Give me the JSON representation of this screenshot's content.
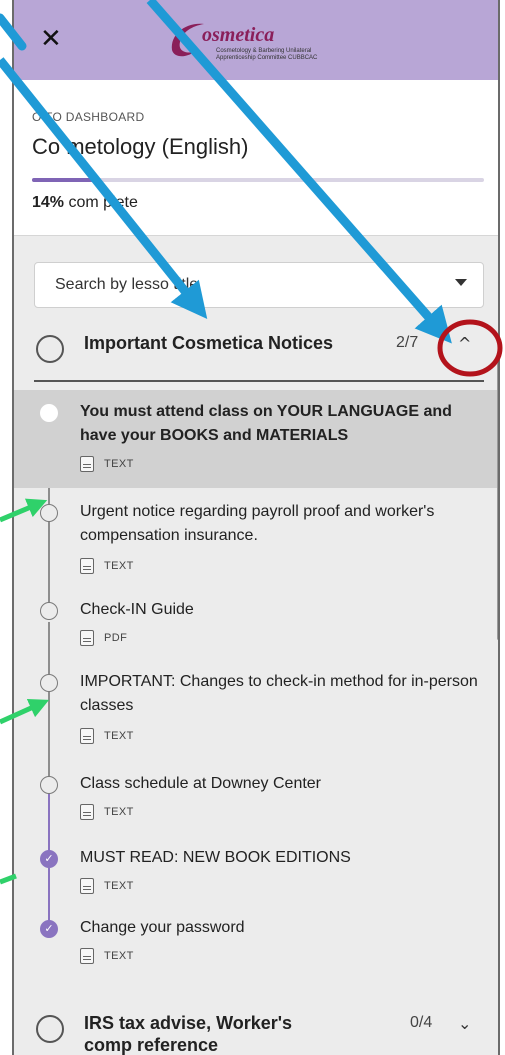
{
  "header": {
    "close_glyph": "✕",
    "logo_name": "osmetica",
    "logo_sub": "Cosmetology & Barbering Unilateral Apprenticeship Committee CUBBCAC"
  },
  "course": {
    "back_label": "O TO DASHBOARD",
    "title": "Co  metology (English)",
    "progress_percent": 14,
    "progress_value": "14%",
    "progress_suffix": " com  plete"
  },
  "search": {
    "placeholder": "Search by lesso  title"
  },
  "sections": [
    {
      "title": "Important Cosmetica Notices",
      "count": "2/7",
      "chevron": "^",
      "expanded": true
    },
    {
      "title": "IRS tax advise, Worker's comp reference",
      "count": "0/4",
      "chevron": "⌄",
      "expanded": false
    }
  ],
  "lessons": [
    {
      "title": "You must attend class on YOUR LANGUAGE and have your BOOKS and MATERIALS",
      "type": "TEXT",
      "done": false,
      "active": true
    },
    {
      "title": "Urgent notice regarding payroll proof and worker's compensation insurance.",
      "type": "TEXT",
      "done": false,
      "active": false
    },
    {
      "title": "Check-IN Guide",
      "type": "PDF",
      "done": false,
      "active": false
    },
    {
      "title": "IMPORTANT: Changes to check-in method for in-person classes",
      "type": "TEXT",
      "done": false,
      "active": false
    },
    {
      "title": "Class schedule at Downey Center",
      "type": "TEXT",
      "done": false,
      "active": false
    },
    {
      "title": "MUST READ: NEW BOOK EDITIONS",
      "type": "TEXT",
      "done": true,
      "active": false
    },
    {
      "title": "Change your password",
      "type": "TEXT",
      "done": true,
      "active": false
    }
  ],
  "colors": {
    "header_bg": "#b8a6d6",
    "accent": "#7f64b5",
    "annotation_blue": "#1f9ad6",
    "annotation_green": "#2fd16a",
    "annotation_red": "#b3131b"
  }
}
